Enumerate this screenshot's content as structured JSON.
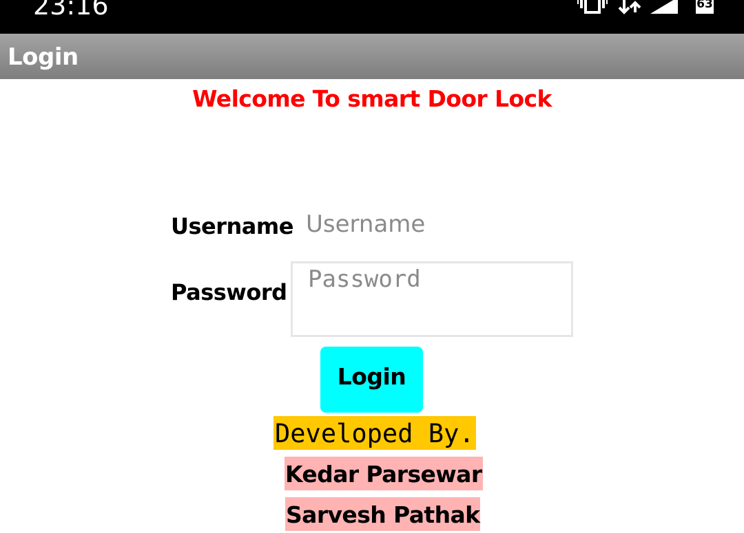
{
  "status_bar": {
    "time": "23:16",
    "battery_level": "63",
    "icons": [
      "vibrate-icon",
      "data-arrows-icon",
      "signal-icon",
      "battery-icon"
    ]
  },
  "action_bar": {
    "title": "Login"
  },
  "welcome_text": "Welcome To smart Door Lock",
  "form": {
    "username_label": "Username",
    "username_placeholder": "Username",
    "password_label": "Password",
    "password_placeholder": "Password",
    "login_button": "Login"
  },
  "credits": {
    "heading": "Developed By.",
    "developers": [
      "Kedar Parsewar",
      "Sarvesh Pathak"
    ]
  },
  "colors": {
    "welcome": "#ff0000",
    "login_button_bg": "#00ffff",
    "developed_by_bg": "#ffc800",
    "developer_bg": "#ffb3b3",
    "action_bar": "#8f8f8f"
  }
}
